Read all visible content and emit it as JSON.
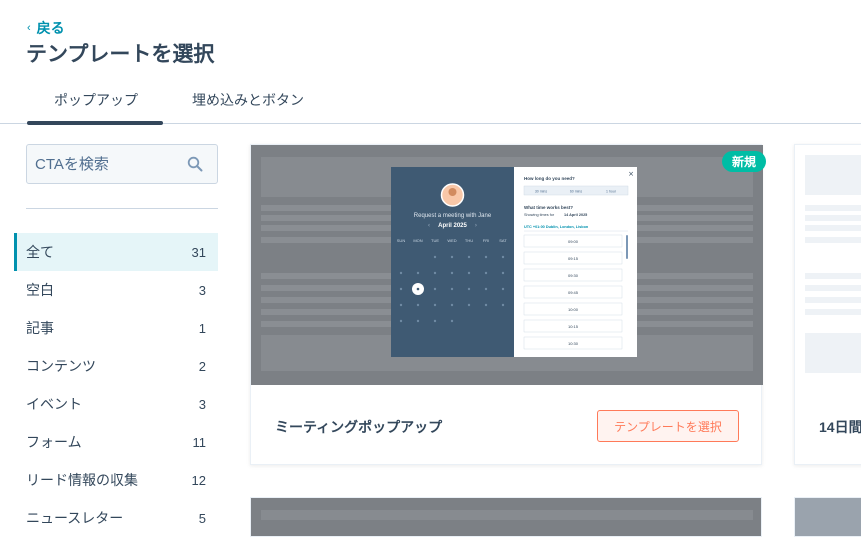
{
  "header": {
    "back_label": "戻る",
    "title": "テンプレートを選択"
  },
  "tabs": [
    {
      "label": "ポップアップ",
      "active": true
    },
    {
      "label": "埋め込みとボタン",
      "active": false
    }
  ],
  "search": {
    "placeholder": "CTAを検索"
  },
  "categories": [
    {
      "label": "全て",
      "count": "31",
      "active": true
    },
    {
      "label": "空白",
      "count": "3"
    },
    {
      "label": "記事",
      "count": "1"
    },
    {
      "label": "コンテンツ",
      "count": "2"
    },
    {
      "label": "イベント",
      "count": "3"
    },
    {
      "label": "フォーム",
      "count": "11"
    },
    {
      "label": "リード情報の収集",
      "count": "12"
    },
    {
      "label": "ニュースレター",
      "count": "5"
    }
  ],
  "cards": [
    {
      "name": "ミーティングポップアップ",
      "button_label": "テンプレートを選択",
      "badge": "新規",
      "preview": {
        "left_title": "Request a meeting with Jane",
        "month": "April 2025",
        "weekdays": [
          "SUN",
          "MON",
          "TUE",
          "WED",
          "THU",
          "FRI",
          "SAT"
        ],
        "question": "How long do you need?",
        "durations": [
          "30 mins",
          "60 mins",
          "1 hour"
        ],
        "time_question": "What time works best?",
        "showing_prefix": "Showing times for",
        "showing_date": "14 April 2025",
        "timezone": "UTC +01:00 Dublin, London, Lisbon",
        "times": [
          "09:00",
          "09:15",
          "09:30",
          "09:45",
          "10:00",
          "10:15",
          "10:30"
        ]
      }
    },
    {
      "name": "14日間"
    }
  ],
  "icons": {
    "back": "chevron-left-icon",
    "search": "search-icon",
    "close": "close-icon"
  },
  "colors": {
    "accent": "#0091ae",
    "cta": "#ff7a59",
    "badge": "#00bda5",
    "text": "#33475b",
    "calendar_bg": "#3f5a73"
  }
}
